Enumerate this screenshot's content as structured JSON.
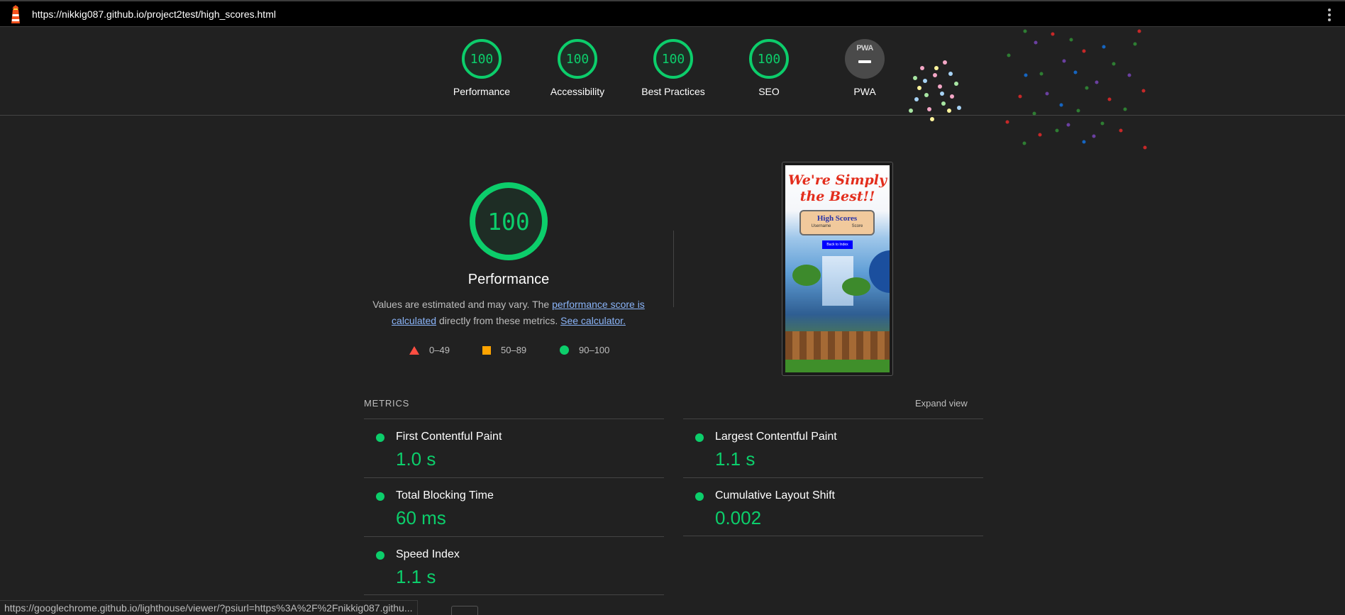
{
  "topbar": {
    "url": "https://nikkig087.github.io/project2test/high_scores.html",
    "logo_icon": "lighthouse-icon",
    "menu_icon": "kebab-menu-icon"
  },
  "summary": {
    "gauges": [
      {
        "score": "100",
        "label": "Performance"
      },
      {
        "score": "100",
        "label": "Accessibility"
      },
      {
        "score": "100",
        "label": "Best Practices"
      },
      {
        "score": "100",
        "label": "SEO"
      }
    ],
    "pwa": {
      "badge": "PWA",
      "label": "PWA"
    }
  },
  "performance": {
    "score": "100",
    "title": "Performance",
    "desc_prefix": "Values are estimated and may vary. The ",
    "desc_link1": "performance score is calculated",
    "desc_middle": " directly from these metrics. ",
    "desc_link2": "See calculator.",
    "legend": [
      {
        "range": "0–49",
        "shape": "triangle",
        "color": "#ff4e42"
      },
      {
        "range": "50–89",
        "shape": "square",
        "color": "#ffa400"
      },
      {
        "range": "90–100",
        "shape": "circle",
        "color": "#0cce6b"
      }
    ]
  },
  "screenshot": {
    "heading": "We're Simply the Best!!",
    "card_title": "High Scores",
    "col_username": "Username",
    "col_score": "Score",
    "button": "Back to Index"
  },
  "metrics": {
    "header": "METRICS",
    "expand_label": "Expand view",
    "left": [
      {
        "name": "First Contentful Paint",
        "value": "1.0 s"
      },
      {
        "name": "Total Blocking Time",
        "value": "60 ms"
      },
      {
        "name": "Speed Index",
        "value": "1.1 s"
      }
    ],
    "right": [
      {
        "name": "Largest Contentful Paint",
        "value": "1.1 s"
      },
      {
        "name": "Cumulative Layout Shift",
        "value": "0.002"
      }
    ]
  },
  "status_bar": {
    "url": "https://googlechrome.github.io/lighthouse/viewer/?psiurl=https%3A%2F%2Fnikkig087.githu..."
  },
  "colors": {
    "pass": "#0cce6b",
    "average": "#ffa400",
    "fail": "#ff4e42",
    "link": "#8ab4f8",
    "background": "#212121"
  }
}
